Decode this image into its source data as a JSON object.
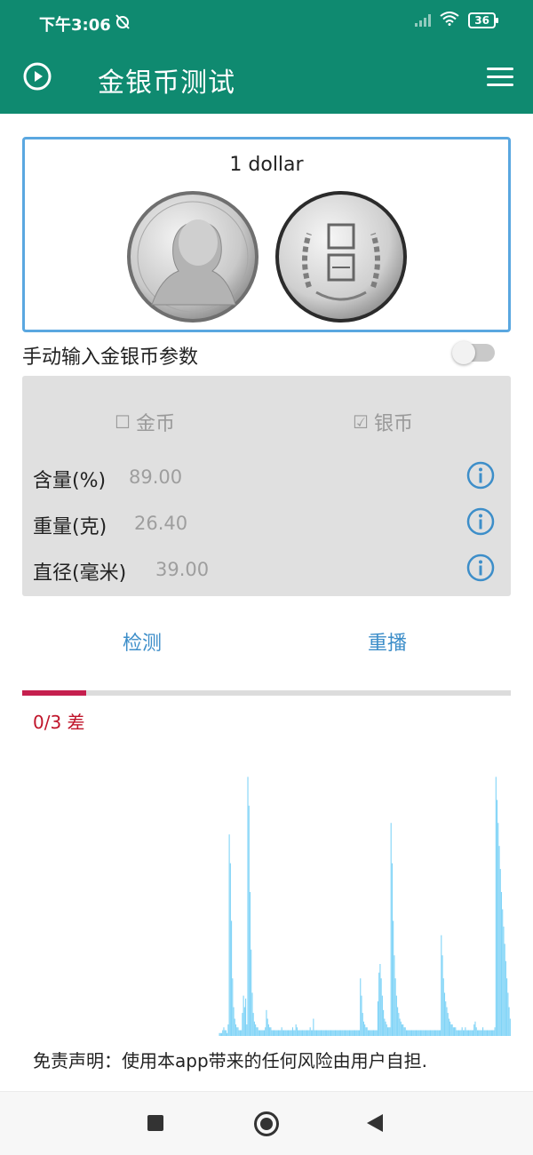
{
  "status_bar": {
    "time": "下午3:06",
    "mute_icon": "alarm-off-icon",
    "wifi_icon": "wifi-icon",
    "battery": "36"
  },
  "app_bar": {
    "title": "金银币测试",
    "left_icon": "play-circle-icon",
    "right_icon": "menu-icon"
  },
  "coin": {
    "name": "1 dollar"
  },
  "manual_input": {
    "label": "手动输入金银币参数",
    "enabled": false
  },
  "params": {
    "type_gold": {
      "label": "金币",
      "checked": false
    },
    "type_silver": {
      "label": "银币",
      "checked": true
    },
    "purity": {
      "label": "含量(%)",
      "value": "89.00"
    },
    "weight": {
      "label": "重量(克)",
      "value": "26.40"
    },
    "diameter": {
      "label": "直径(毫米)",
      "value": "39.00"
    }
  },
  "actions": {
    "detect": "检测",
    "replay": "重播"
  },
  "progress": {
    "text": "0/3 差",
    "fraction": 0.13
  },
  "waveform": {
    "color": "#81d4f7",
    "bars": [
      0,
      0,
      0,
      0,
      0,
      0,
      0,
      0,
      0,
      0,
      0,
      0,
      0,
      0,
      0,
      0,
      0,
      0,
      0,
      0,
      0,
      0,
      0,
      0,
      0,
      0,
      0,
      0,
      0,
      0,
      0,
      0,
      0,
      0,
      0,
      0,
      0,
      0,
      0,
      0,
      0,
      0,
      0,
      0,
      0,
      0,
      0,
      0,
      0,
      0,
      0,
      0,
      0,
      0,
      0,
      0,
      0,
      0,
      0,
      0,
      0,
      0,
      0,
      0,
      0,
      0,
      0,
      0,
      0,
      0,
      0,
      0,
      0,
      0,
      0,
      0,
      0,
      0,
      0,
      0,
      0,
      0,
      0,
      0,
      0,
      0,
      0,
      0,
      0,
      0,
      0,
      0,
      0,
      0,
      0,
      0,
      0,
      0,
      0,
      0,
      0,
      0,
      0,
      0,
      0,
      0,
      0,
      0,
      0,
      0,
      0,
      0,
      0,
      0,
      0,
      0,
      0,
      0,
      0,
      0,
      0,
      0,
      0,
      0,
      0,
      0,
      0,
      0,
      0,
      0,
      0,
      0,
      0,
      0,
      0,
      0,
      0,
      0,
      0,
      0,
      0,
      0,
      0,
      0,
      0,
      0,
      0,
      0,
      0,
      0,
      0,
      0,
      0,
      0,
      0,
      0,
      0,
      0,
      0,
      0,
      0,
      0,
      0,
      0,
      0,
      0,
      0,
      0,
      0,
      0,
      0,
      0,
      0,
      0,
      0,
      0,
      0,
      0,
      0,
      0,
      1,
      1,
      1,
      2,
      3,
      2,
      2,
      1,
      4,
      70,
      60,
      40,
      20,
      10,
      6,
      4,
      3,
      3,
      2,
      2,
      2,
      8,
      14,
      10,
      13,
      4,
      90,
      80,
      50,
      30,
      15,
      8,
      5,
      4,
      3,
      3,
      2,
      2,
      2,
      2,
      2,
      2,
      3,
      9,
      6,
      4,
      3,
      3,
      2,
      2,
      2,
      2,
      2,
      2,
      2,
      2,
      2,
      3,
      2,
      2,
      2,
      2,
      2,
      2,
      2,
      2,
      2,
      3,
      2,
      2,
      4,
      3,
      2,
      2,
      2,
      2,
      2,
      2,
      2,
      2,
      2,
      2,
      2,
      3,
      2,
      2,
      6,
      2,
      2,
      2,
      2,
      2,
      2,
      2,
      2,
      2,
      2,
      2,
      2,
      2,
      2,
      2,
      2,
      2,
      2,
      2,
      2,
      2,
      2,
      2,
      2,
      2,
      2,
      2,
      2,
      2,
      2,
      2,
      2,
      2,
      2,
      2,
      2,
      2,
      2,
      2,
      2,
      2,
      2,
      20,
      14,
      8,
      5,
      4,
      3,
      3,
      2,
      2,
      2,
      2,
      2,
      2,
      2,
      2,
      2,
      12,
      22,
      25,
      20,
      14,
      9,
      6,
      5,
      4,
      3,
      3,
      3,
      74,
      60,
      40,
      28,
      20,
      14,
      10,
      8,
      6,
      5,
      4,
      4,
      3,
      3,
      2,
      2,
      2,
      2,
      2,
      2,
      2,
      2,
      2,
      2,
      2,
      2,
      2,
      2,
      2,
      2,
      2,
      2,
      2,
      2,
      2,
      2,
      2,
      2,
      2,
      2,
      2,
      2,
      2,
      2,
      2,
      2,
      35,
      28,
      20,
      15,
      12,
      10,
      8,
      6,
      5,
      4,
      4,
      3,
      3,
      3,
      2,
      2,
      2,
      2,
      2,
      3,
      2,
      2,
      3,
      2,
      2,
      2,
      2,
      2,
      2,
      2,
      4,
      5,
      3,
      2,
      2,
      2,
      2,
      2,
      3,
      2,
      2,
      2,
      2,
      2,
      2,
      2,
      2,
      2,
      2,
      3,
      90,
      82,
      74,
      66,
      58,
      50,
      44,
      38,
      32,
      26,
      20,
      15,
      10,
      6
    ],
    "max": 100
  },
  "disclaimer": "免责声明：使用本app带来的任何风险由用户自担.",
  "nav": {
    "stop": "stop-icon",
    "home": "home-icon",
    "back": "back-icon"
  }
}
